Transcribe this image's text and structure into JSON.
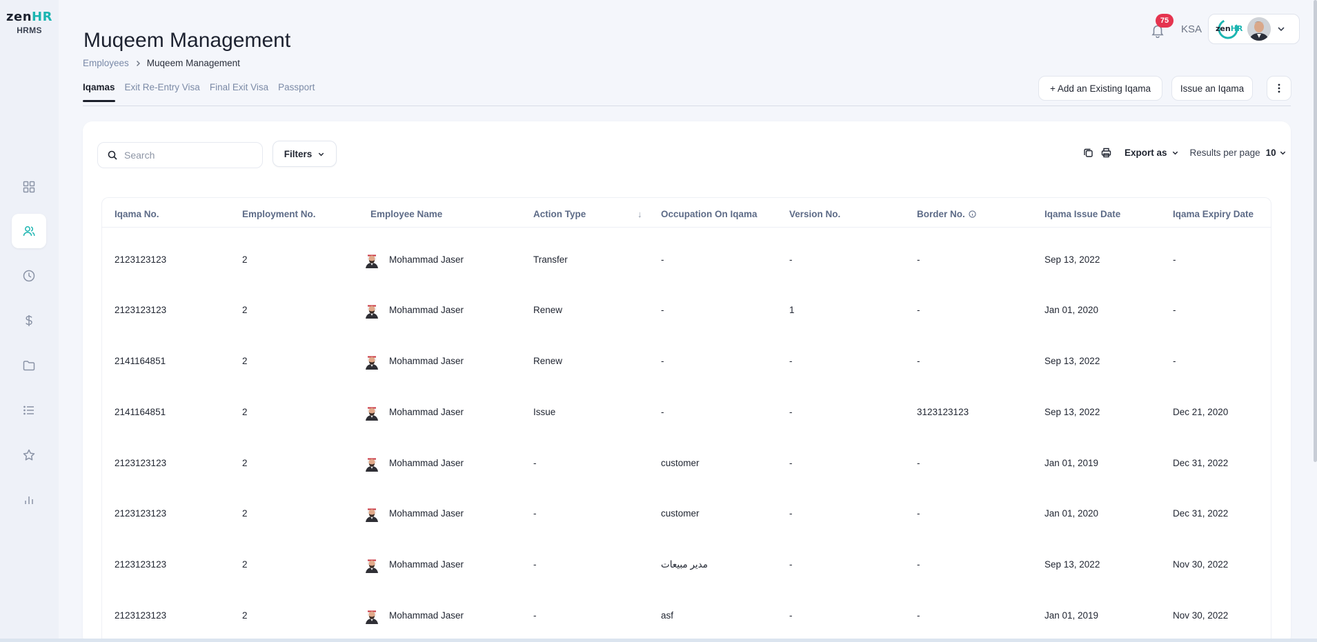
{
  "app": {
    "logo_main": "zen",
    "logo_accent": "HR",
    "logo_sub": "HRMS"
  },
  "colors": {
    "accent": "#1cb5b1",
    "badge": "#e5344f",
    "tab_active": "#1b1f2a",
    "header_text": "#5d6b87"
  },
  "sidebar": {
    "items": [
      {
        "name": "dashboard",
        "icon": "grid-icon",
        "active": false
      },
      {
        "name": "employees",
        "icon": "users-icon",
        "active": true
      },
      {
        "name": "attendance",
        "icon": "clock-icon",
        "active": false
      },
      {
        "name": "payroll",
        "icon": "dollar-icon",
        "active": false
      },
      {
        "name": "documents",
        "icon": "folder-icon",
        "active": false
      },
      {
        "name": "lists",
        "icon": "list-icon",
        "active": false
      },
      {
        "name": "performance",
        "icon": "star-icon",
        "active": false
      },
      {
        "name": "reports",
        "icon": "bar-chart-icon",
        "active": false
      }
    ]
  },
  "header": {
    "notifications_count": "75",
    "country": "KSA",
    "company_logo_main": "zen",
    "company_logo_accent": "HR"
  },
  "page": {
    "title": "Muqeem Management",
    "breadcrumb": [
      "Employees",
      "Muqeem Management"
    ]
  },
  "tabs": [
    {
      "label": "Iqamas",
      "active": true
    },
    {
      "label": "Exit Re-Entry Visa",
      "active": false
    },
    {
      "label": "Final Exit Visa",
      "active": false
    },
    {
      "label": "Passport",
      "active": false
    }
  ],
  "actions": {
    "add_existing": "+ Add an Existing Iqama",
    "issue": "Issue an Iqama"
  },
  "toolbar": {
    "search_placeholder": "Search",
    "filters_label": "Filters",
    "export_label": "Export as",
    "results_per_page_label": "Results per page",
    "results_per_page_value": "10"
  },
  "table": {
    "columns": [
      "Iqama No.",
      "Employment No.",
      "Employee Name",
      "Action Type",
      "Occupation On Iqama",
      "Version No.",
      "Border No.",
      "Iqama Issue Date",
      "Iqama Expiry Date"
    ],
    "rows": [
      [
        "2123123123",
        "2",
        "Mohammad Jaser",
        "Transfer",
        "-",
        "-",
        "-",
        "Sep 13, 2022",
        "-"
      ],
      [
        "2123123123",
        "2",
        "Mohammad Jaser",
        "Renew",
        "-",
        "1",
        "-",
        "Jan 01, 2020",
        "-"
      ],
      [
        "2141164851",
        "2",
        "Mohammad Jaser",
        "Renew",
        "-",
        "-",
        "-",
        "Sep 13, 2022",
        "-"
      ],
      [
        "2141164851",
        "2",
        "Mohammad Jaser",
        "Issue",
        "-",
        "-",
        "3123123123",
        "Sep 13, 2022",
        "Dec 21, 2020"
      ],
      [
        "2123123123",
        "2",
        "Mohammad Jaser",
        "-",
        "customer",
        "-",
        "-",
        "Jan 01, 2019",
        "Dec 31, 2022"
      ],
      [
        "2123123123",
        "2",
        "Mohammad Jaser",
        "-",
        "customer",
        "-",
        "-",
        "Jan 01, 2020",
        "Dec 31, 2022"
      ],
      [
        "2123123123",
        "2",
        "Mohammad Jaser",
        "-",
        "مدير مبيعات",
        "-",
        "-",
        "Sep 13, 2022",
        "Nov 30, 2022"
      ],
      [
        "2123123123",
        "2",
        "Mohammad Jaser",
        "-",
        "asf",
        "-",
        "-",
        "Jan 01, 2019",
        "Nov 30, 2022"
      ]
    ]
  }
}
